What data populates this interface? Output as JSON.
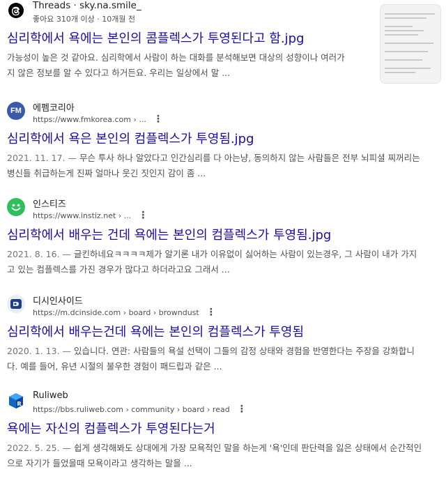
{
  "results": [
    {
      "site": "Threads · sky.na.smile_",
      "meta": "좋아요 310개 이상 · 10개월 전",
      "title": "심리학에서 욕에는 본인의 콤플렉스가 투영된다고 함.jpg",
      "snippet_1": "가능성이 높은 것 같아요. 심리학에서 사람이 하는 대화를 분석해보면 대상의 성향이나 여러가",
      "snippet_2": "지 않은 정보를 알 수 있다고 하거든요. 우리는 일상에서 말 ...",
      "icon": "threads-logo-icon",
      "color": "#000000"
    },
    {
      "site": "에펨코리아",
      "url": "https://www.fmkorea.com › ...",
      "favicon_text": "FM",
      "title": "심리학에서 욕은 본인의 컴플렉스가 투영됨.jpg",
      "date": "2021. 11. 17. —",
      "snippet_1": " 무슨 투사 하나 알았다고 인간심리를 다 아는냥, 동의하지 않는 사람들은 전부 뇌피셜 찌꺼리는",
      "snippet_2": "병신들 취급하는게 진짜 얼마나 웃긴 짓인지 감이 좀 ...",
      "icon": "fmkorea-logo-icon",
      "color": "#3a5aa8"
    },
    {
      "site": "인스티즈",
      "url": "https://www.instiz.net › ...",
      "title": "심리학에서 배우는 건데 욕에는 본인의 컴플렉스가 투영됨.jpg",
      "date": "2021. 8. 16. —",
      "snippet_1": " 글킨하네요ㅋㅋㅋㅋ제가 알기론 내가 이유없이 싫어하는 사람이 있는경우, 그 사람이 내가 가지",
      "snippet_2": "고 있는 컴플렉스를 가진 경우가 많다고 하더라고요 그래서 ...",
      "icon": "instiz-smiley-icon",
      "color": "#2ec05a"
    },
    {
      "site": "디시인사이드",
      "url": "https://m.dcinside.com › board › browndust",
      "title": "심리학에서 배우는건데 욕에는 본인의 컴플렉스가 투영됨",
      "date": "2020. 1. 13. —",
      "snippet_1": " 있습니다. 연관: 사람들의 욕설 선택이 그들의 감정 상태와 경험을 반영한다는 주장을 강화합니",
      "snippet_2": "다. 예를 들어, 유년 시절의 불우한 경험이 패드립과 같은 ...",
      "icon": "dcinside-logo-icon",
      "color": "#1b3f8b"
    },
    {
      "site": "Ruliweb",
      "url": "https://bbs.ruliweb.com › community › board › read",
      "title": "욕에는 자신의 컴플렉스가 투영된다는거",
      "date": "2022. 5. 25. —",
      "snippet_1": " 쉽게 생각해봐도 상대에게 가장 모욕적인 말을 하는게 '욕'인데 판단력을 잃은 상태에서 순간적인",
      "snippet_2": "으로 자기가 들었을때 모욕이라고 생각하는 말을 ...",
      "icon": "ruliweb-logo-icon",
      "color": "#1565c0"
    }
  ],
  "more_icon": "more-vert-icon",
  "thumbnail_icon": "result-thumbnail-image"
}
